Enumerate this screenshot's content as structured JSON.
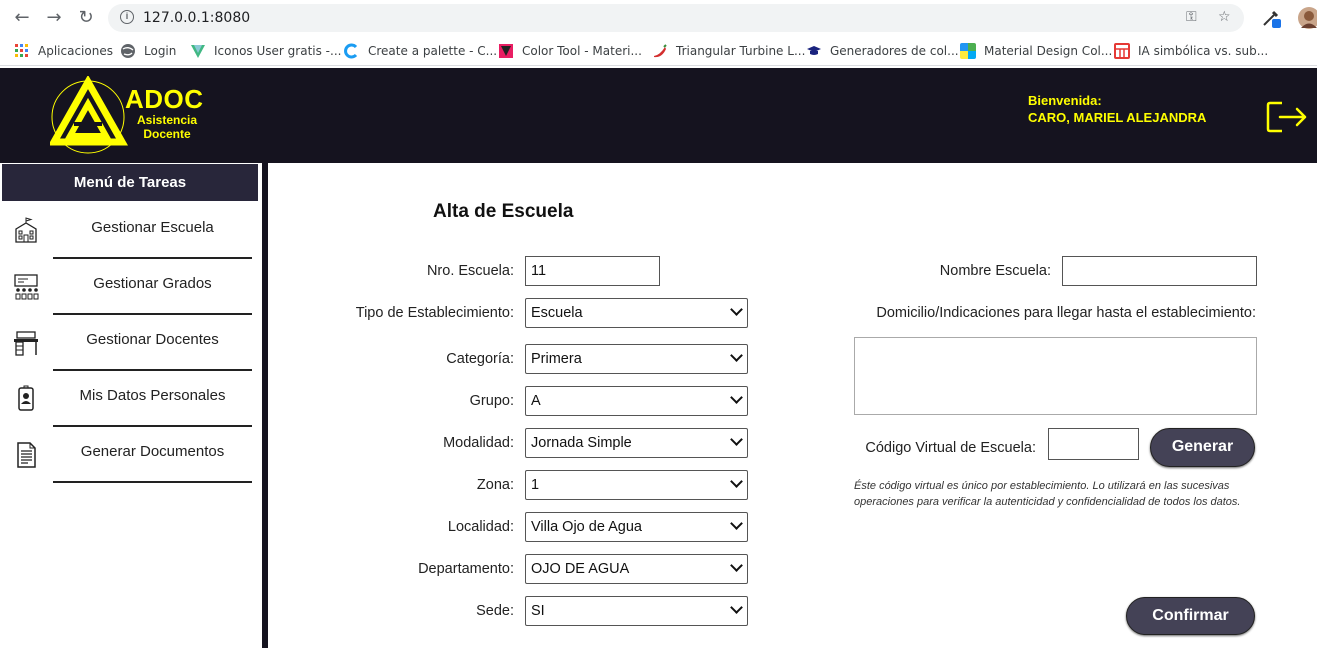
{
  "browser": {
    "url": "127.0.0.1:8080",
    "bookmarks": [
      {
        "label": "Aplicaciones",
        "icon": "apps-grid-icon"
      },
      {
        "label": "Login",
        "icon": "globe-icon"
      },
      {
        "label": "Iconos User gratis -...",
        "icon": "vuetify-icon"
      },
      {
        "label": "Create a palette - C...",
        "icon": "c-logo-icon"
      },
      {
        "label": "Color Tool - Materi...",
        "icon": "material-icon"
      },
      {
        "label": "Triangular Turbine L...",
        "icon": "chili-icon"
      },
      {
        "label": "Generadores de col...",
        "icon": "graduation-cap-icon"
      },
      {
        "label": "Material Design Col...",
        "icon": "material-palette-icon"
      },
      {
        "label": "IA simbólica vs. sub...",
        "icon": "table-icon"
      }
    ]
  },
  "header": {
    "brand": "ADOC",
    "brand_sub_1": "Asistencia",
    "brand_sub_2": "Docente",
    "welcome": "Bienvenida:",
    "user_name": "CARO, MARIEL ALEJANDRA"
  },
  "sidebar": {
    "title": "Menú de Tareas",
    "items": [
      {
        "label": "Gestionar Escuela",
        "icon": "school-icon"
      },
      {
        "label": "Gestionar Grados",
        "icon": "classroom-icon"
      },
      {
        "label": "Gestionar Docentes",
        "icon": "desk-icon"
      },
      {
        "label": "Mis Datos Personales",
        "icon": "id-card-icon"
      },
      {
        "label": "Generar Documentos",
        "icon": "document-icon"
      }
    ]
  },
  "form": {
    "title": "Alta de Escuela",
    "nro_escuela_label": "Nro. Escuela:",
    "nro_escuela_value": "11",
    "tipo_label": "Tipo de Establecimiento:",
    "tipo_value": "Escuela",
    "categoria_label": "Categoría:",
    "categoria_value": "Primera",
    "grupo_label": "Grupo:",
    "grupo_value": "A",
    "modalidad_label": "Modalidad:",
    "modalidad_value": "Jornada Simple",
    "zona_label": "Zona:",
    "zona_value": "1",
    "localidad_label": "Localidad:",
    "localidad_value": "Villa Ojo de Agua",
    "departamento_label": "Departamento:",
    "departamento_value": "OJO DE AGUA",
    "sede_label": "Sede:",
    "sede_value": "SI",
    "nombre_label": "Nombre Escuela:",
    "nombre_value": "",
    "domicilio_label": "Domicilio/Indicaciones para llegar hasta el establecimiento:",
    "codigo_label": "Código Virtual de Escuela:",
    "codigo_value": "",
    "generar_label": "Generar",
    "note": "Éste código virtual es único por establecimiento. Lo utilizará en las sucesivas operaciones para verificar la autenticidad y confidencialidad de todos los datos.",
    "confirmar_label": "Confirmar"
  },
  "colors": {
    "header_bg": "#15131f",
    "accent_yellow": "#ffff00",
    "menu_header_bg": "#28263a",
    "button_bg": "#444256"
  }
}
